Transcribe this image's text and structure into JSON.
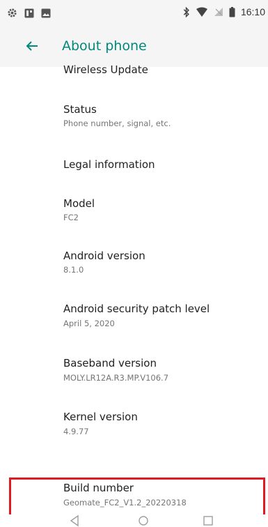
{
  "status_bar": {
    "left_icons": [
      "settings-icon",
      "notification-app-icon",
      "image-icon"
    ],
    "right_icons": [
      "bluetooth-icon",
      "vpn-shield-icon",
      "no-signal-icon",
      "battery-icon"
    ],
    "time": "16:10"
  },
  "app_bar": {
    "title": "About phone",
    "accent_color": "#00897b"
  },
  "items": [
    {
      "title": "Wireless Update",
      "subtitle": ""
    },
    {
      "title": "Status",
      "subtitle": "Phone number, signal, etc."
    },
    {
      "title": "Legal information",
      "subtitle": ""
    },
    {
      "title": "Model",
      "subtitle": "FC2"
    },
    {
      "title": "Android version",
      "subtitle": "8.1.0"
    },
    {
      "title": "Android security patch level",
      "subtitle": "April 5, 2020"
    },
    {
      "title": "Baseband version",
      "subtitle": "MOLY.LR12A.R3.MP.V106.7"
    },
    {
      "title": "Kernel version",
      "subtitle": "4.9.77"
    },
    {
      "title": "Build number",
      "subtitle": "Geomate_FC2_V1.2_20220318"
    }
  ],
  "highlight_color": "#e11b22",
  "nav_bar": {
    "icons": [
      "back-triangle-icon",
      "home-circle-icon",
      "recents-square-icon"
    ]
  }
}
